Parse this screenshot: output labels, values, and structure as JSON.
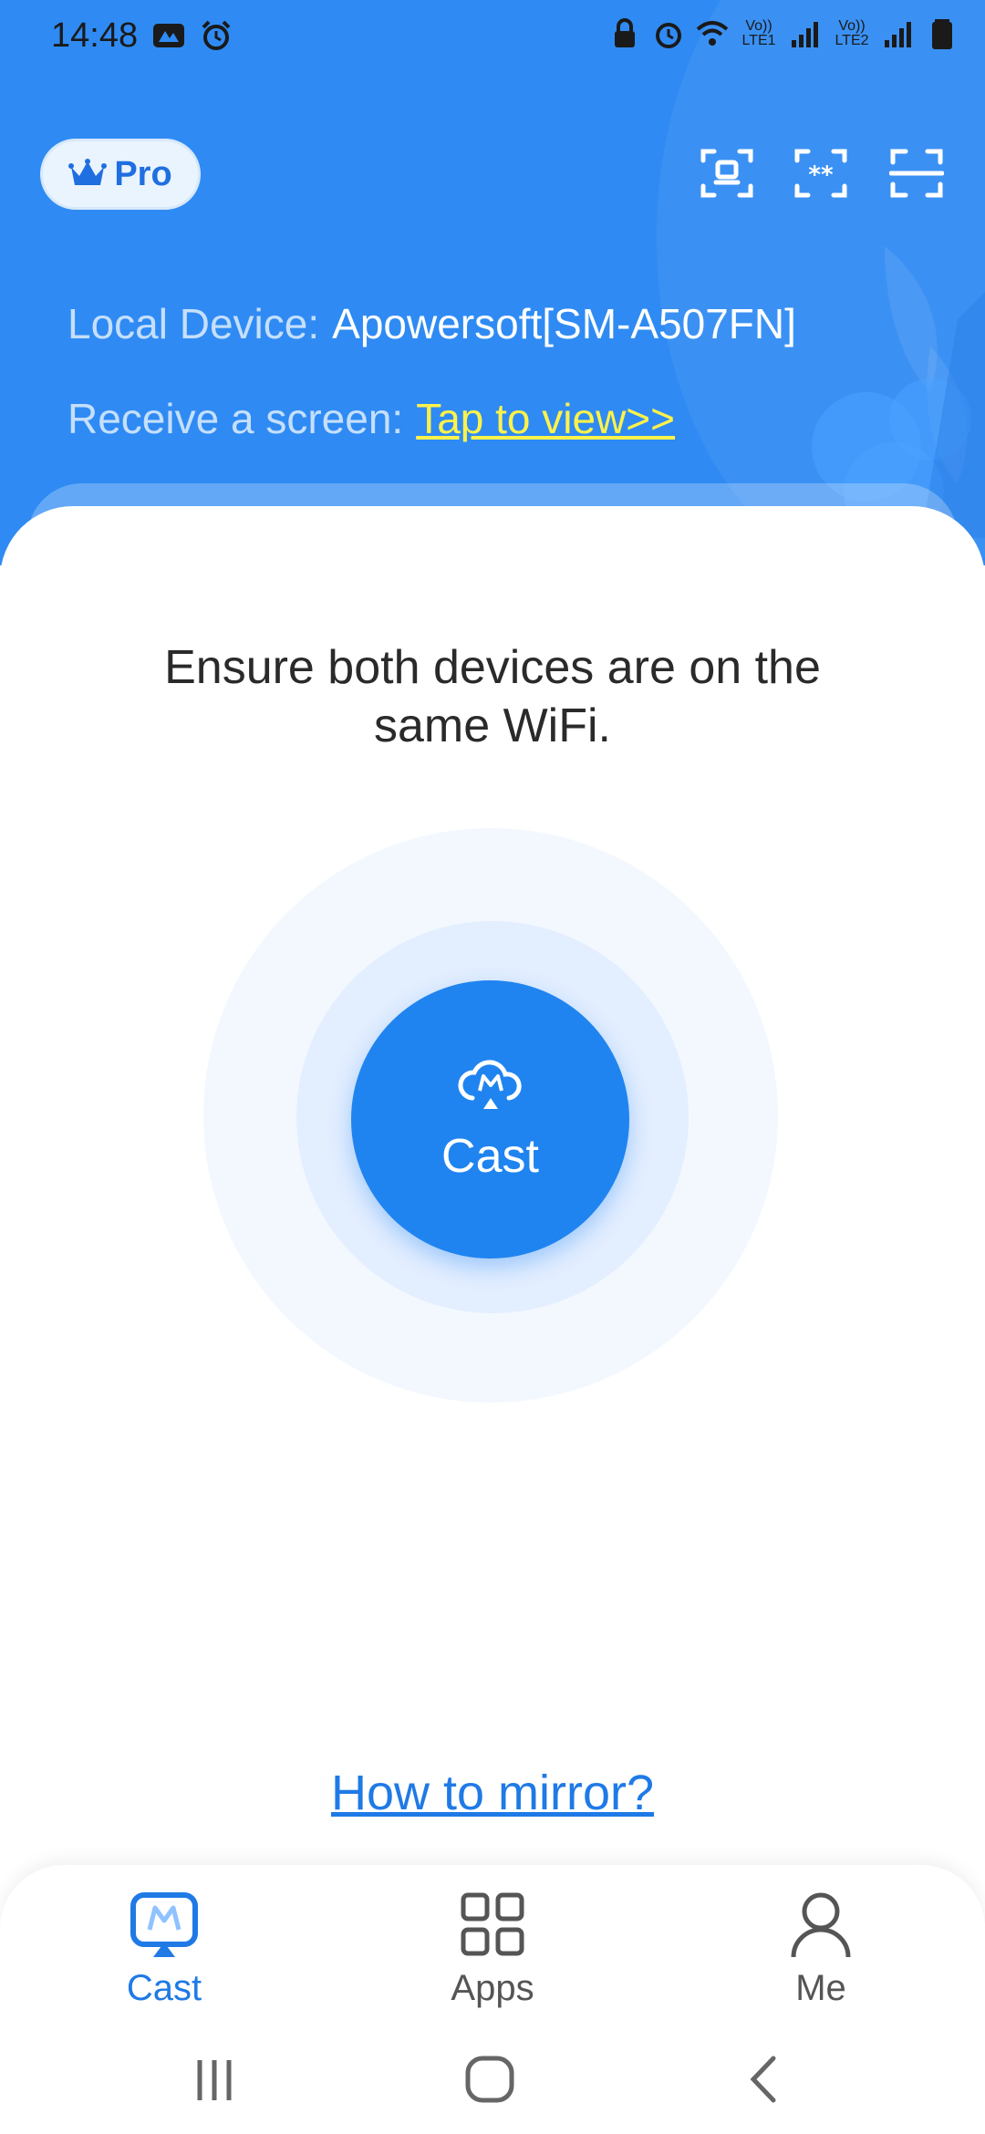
{
  "status_bar": {
    "time": "14:48",
    "left_icons": [
      "app-notification-icon",
      "alarm-icon"
    ],
    "right_icons": [
      "lock-icon",
      "alarm-icon",
      "wifi-icon",
      "signal-sim1-icon",
      "signal-sim2-icon",
      "battery-icon"
    ],
    "sim1_label": "Vo)) LTE1",
    "sim2_label": "Vo)) LTE2"
  },
  "header": {
    "pro_label": "Pro",
    "icons": [
      "screen-mirror-code-icon",
      "pin-code-icon",
      "scan-icon"
    ],
    "local_device_label": "Local Device:",
    "local_device_value": "Apowersoft[SM-A507FN]",
    "receive_label": "Receive a screen:",
    "receive_link": "Tap to view>>"
  },
  "main": {
    "instruction": "Ensure both devices are on the same WiFi.",
    "cast_label": "Cast",
    "howto_link": "How to mirror?"
  },
  "bottom_nav": {
    "items": [
      {
        "label": "Cast",
        "icon": "cast-icon",
        "active": true
      },
      {
        "label": "Apps",
        "icon": "apps-grid-icon",
        "active": false
      },
      {
        "label": "Me",
        "icon": "person-icon",
        "active": false
      }
    ]
  },
  "colors": {
    "brand_blue": "#2f8bf3",
    "cast_button": "#1f84f0",
    "link_yellow": "#fff24a",
    "link_blue": "#1f7ae6"
  }
}
